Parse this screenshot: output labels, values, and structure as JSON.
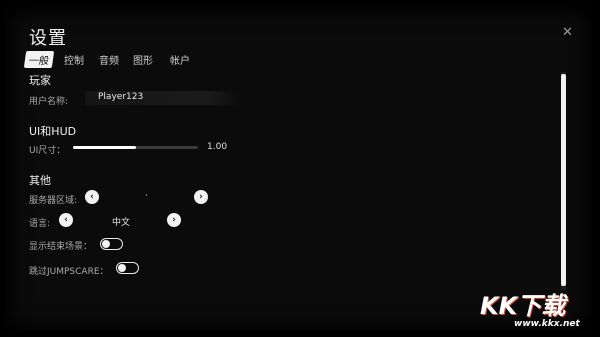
{
  "title": "设置",
  "tabs": [
    {
      "label": "一般",
      "active": true
    },
    {
      "label": "控制",
      "active": false
    },
    {
      "label": "音频",
      "active": false
    },
    {
      "label": "图形",
      "active": false
    },
    {
      "label": "帐户",
      "active": false
    }
  ],
  "player": {
    "section": "玩家",
    "username_label": "用户名称:",
    "username_value": "Player123"
  },
  "ui_hud": {
    "section": "UI和HUD",
    "ui_size_label": "UI尺寸：",
    "ui_size_value": "1.00",
    "ui_size_fraction": 0.5
  },
  "other": {
    "section": "其他",
    "server_region_label": "服务器区域:",
    "server_region_value": "·",
    "language_label": "语言:",
    "language_value": "中文",
    "show_end_scene_label": "显示结束场景：",
    "show_end_scene_on": false,
    "skip_jumpscare_label": "跳过JUMPSCARE：",
    "skip_jumpscare_on": false
  },
  "icons": {
    "close": "close-icon",
    "prev": "chevron-left-icon",
    "next": "chevron-right-icon"
  },
  "watermark": {
    "brand": "KK下载",
    "url": "www.kkx.net"
  }
}
